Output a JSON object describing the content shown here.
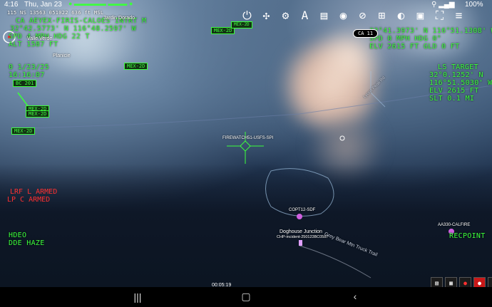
{
  "status_bar": {
    "time": "4:16",
    "date": "Thu, Jan 23",
    "battery": "100%"
  },
  "hud_left": {
    "line1": "115 NS 13563 051022 636 ft MSL",
    "line2": "CA  AEYEX-FIRIS-CALOES INTRT  M",
    "line3": "32°42.5773' N   116°48.2597' W",
    "line4": "SPD   4 MPH      HDG    22  T",
    "line5": "ALT   1587  FT",
    "date_line": "0 1/23/25",
    "time_line": "16:16:07"
  },
  "hud_right": {
    "line1": "32°41.3973' N     116°51.1308' W",
    "line2": "SPD      0 MPH    HDG      0°",
    "line3": "ELV   2615 FT     GLD      0   FT",
    "target_title": "LS TARGET",
    "target_lat": "32°0.1252' N",
    "target_lon": "116°51.5030' W",
    "target_elv": "ELV    2615 FT",
    "target_slt": "SLT      0.1 MI"
  },
  "armed": {
    "lrf": "LRF L ARMED",
    "lpc": "LP  C ARMED"
  },
  "mode": {
    "video": "HDEO",
    "filter": "DDE HAZE"
  },
  "place_labels": {
    "jardin": "Jardin Dorado",
    "valle": "Valle Verde",
    "planicie": "Planicie",
    "doghouse": "Doghouse Junction",
    "doghouse_sub": "CHP-incident-250123BC0587",
    "firewatch": "FIREWATCH51-USFS-SPI",
    "copt": "COPT12-SDF",
    "aa": "AA330-CALFIRE",
    "recpoint": "RECPOINT",
    "road": "Grey Bear Mtn Truck Trail",
    "road2": "Lyons Peak Rd"
  },
  "tags": {
    "mex1": "MEX-2D",
    "mex2": "MEX-2D",
    "mex3": "MEX-2D",
    "mex4": "MEX-2D",
    "mex5": "MEX-2D",
    "mex6": "MEX-2D",
    "bc": "BC 201",
    "ca": "CA 11"
  },
  "recording": {
    "time": "00:05:19"
  },
  "toolbar": {
    "icons": [
      "power-icon",
      "drone-icon",
      "gear-icon",
      "text-icon",
      "film-icon",
      "camera-icon",
      "target-icon",
      "grid-icon",
      "contrast-icon",
      "layers-icon",
      "map-icon",
      "menu-icon"
    ]
  },
  "colors": {
    "hud_green": "#3cff3c",
    "armed_red": "#ff3030"
  }
}
